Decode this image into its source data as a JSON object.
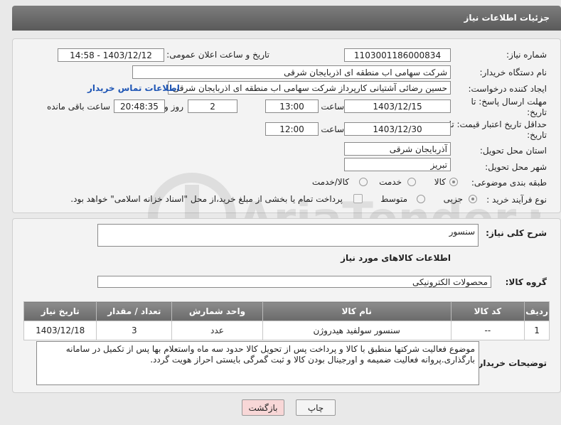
{
  "header": {
    "title": "جزئیات اطلاعات نیاز"
  },
  "form": {
    "need_number_label": "شماره نیاز:",
    "need_number": "1103001186000834",
    "announce_label": "تاریخ و ساعت اعلان عمومی:",
    "announce_value": "1403/12/12 - 14:58",
    "buyer_org_label": "نام دستگاه خریدار:",
    "buyer_org": "شرکت سهامی اب منطقه ای اذربایجان شرقی",
    "requester_label": "ایجاد کننده درخواست:",
    "requester": "حسین رضائی آشتیانی کارپرداز شرکت سهامی اب منطقه ای اذربایجان شرقی",
    "buyer_contact_link": "اطلاعات تماس خریدار",
    "deadline_label_1": "مهلت ارسال پاسخ: تا",
    "deadline_label_2": "تاریخ:",
    "deadline_date": "1403/12/15",
    "time_label": "ساعت",
    "deadline_time": "13:00",
    "days_value": "2",
    "days_label": "روز و",
    "remaining_time": "20:48:35",
    "remaining_label": "ساعت باقی مانده",
    "validity_label_1": "حداقل تاریخ اعتبار قیمت: تا",
    "validity_label_2": "تاریخ:",
    "validity_date": "1403/12/30",
    "validity_time": "12:00",
    "province_label": "استان محل تحویل:",
    "province": "آذربایجان شرقی",
    "city_label": "شهر محل تحویل:",
    "city": "تبریز",
    "category_label": "طبقه بندی موضوعی:",
    "category_options": [
      "کالا",
      "خدمت",
      "کالا/خدمت"
    ],
    "process_label": "نوع فرآیند خرید :",
    "process_options": [
      "جزیی",
      "متوسط"
    ],
    "payment_note": "پرداخت تمام یا بخشی از مبلغ خرید،از محل \"اسناد خزانه اسلامی\" خواهد بود."
  },
  "details": {
    "summary_label": "شرح کلی نیاز:",
    "summary": "سنسور",
    "items_title": "اطلاعات کالاهای مورد نیاز",
    "group_label": "گروه کالا:",
    "group": "محصولات الکترونیکی",
    "table": {
      "headers": [
        "ردیف",
        "کد کالا",
        "نام کالا",
        "واحد شمارش",
        "تعداد / مقدار",
        "تاریخ نیاز"
      ],
      "rows": [
        [
          "1",
          "--",
          "سنسور سولفید هیدروژن",
          "عدد",
          "3",
          "1403/12/18"
        ]
      ]
    },
    "buyer_notes_label": "توضیحات خریدار:",
    "buyer_notes": "موضوع فعالیت شرکتها منطبق با کالا و پرداخت پس از تحویل کالا حدود سه  ماه واستعلام بها پس از تکمیل در سامانه بارگذاری.پروانه فعالیت ضمیمه و اورجینال بودن کالا و ثبت گمرگی بایستی احراز هویت گردد."
  },
  "buttons": {
    "print": "چاپ",
    "back": "بازگشت"
  },
  "watermark": {
    "text": "AriaTender.neT"
  },
  "colors": {
    "header": "#6b6b6b",
    "link": "#1f56b5",
    "back_button_bg": "#f8d7d7"
  }
}
